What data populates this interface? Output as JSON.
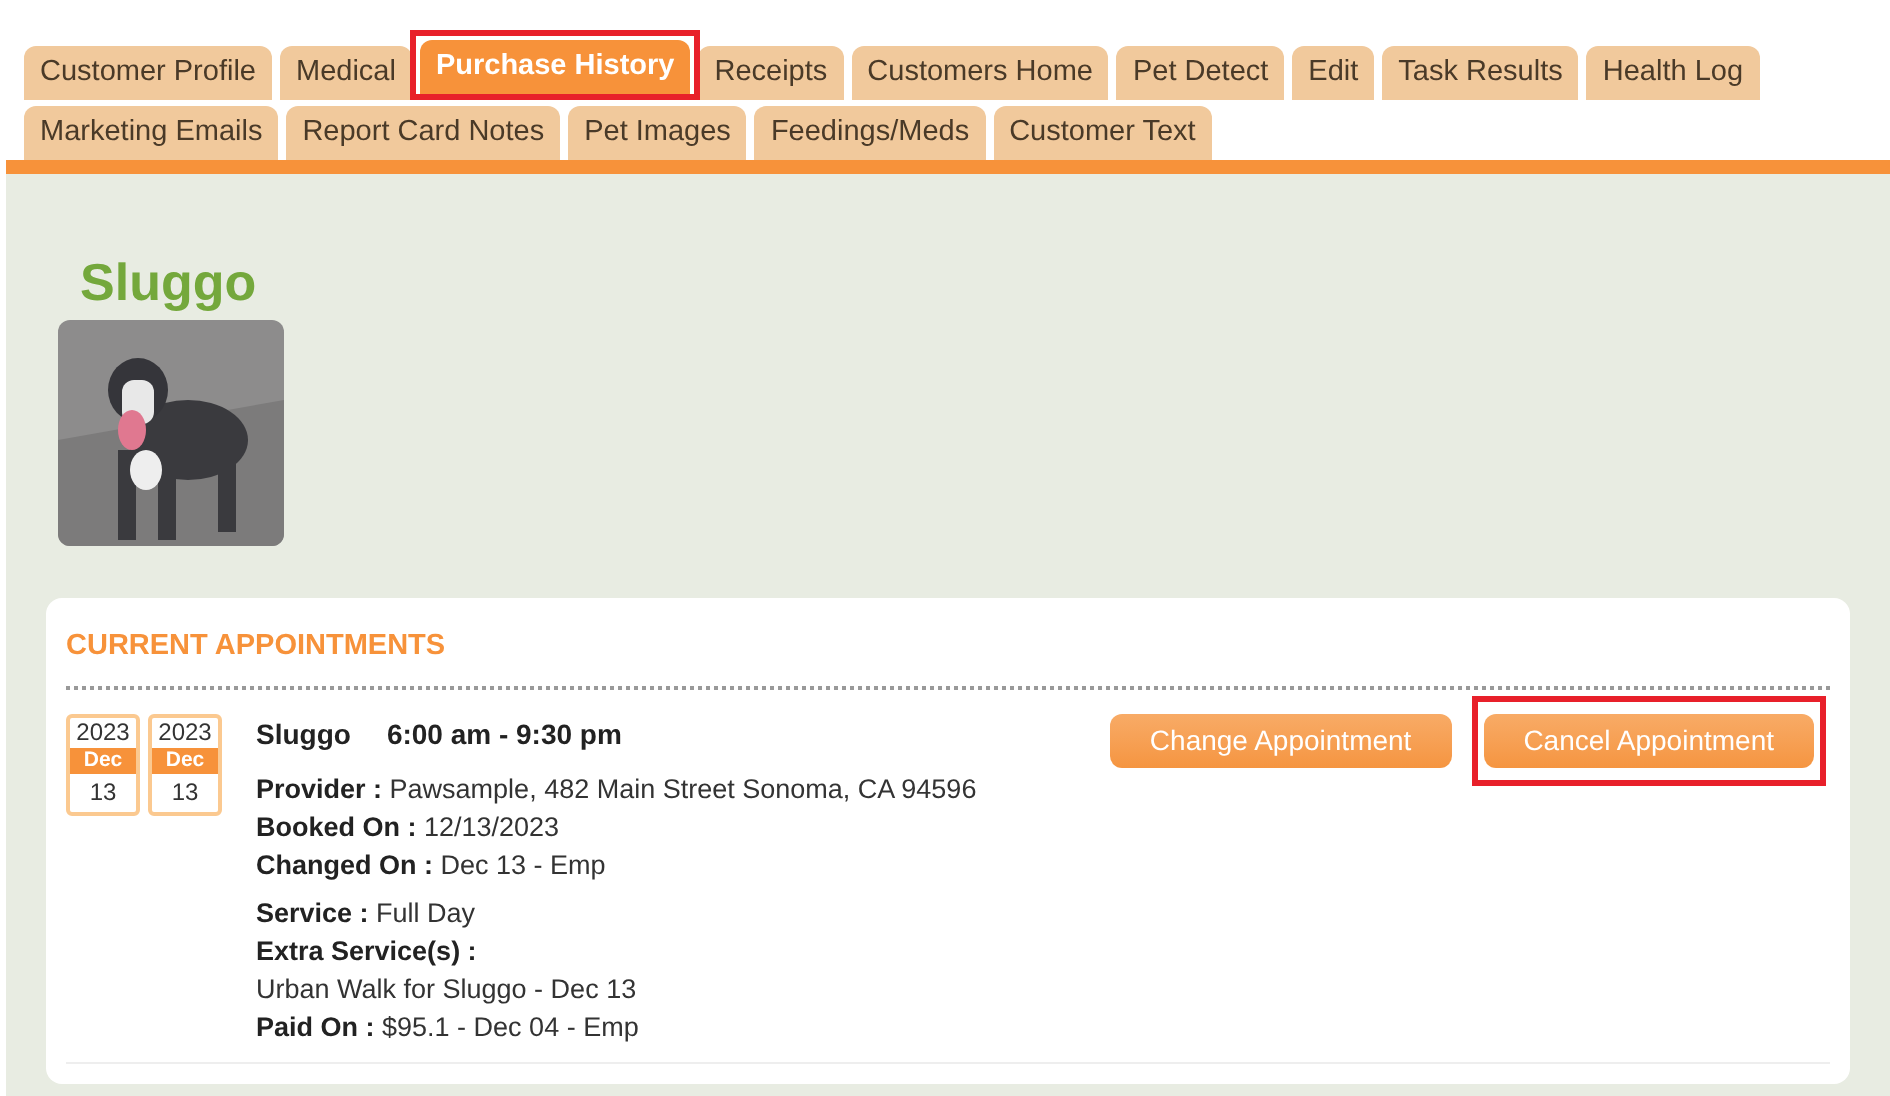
{
  "tab_rows": [
    [
      {
        "label": "Customer Profile",
        "selected": false,
        "highlighted": false
      },
      {
        "label": "Medical",
        "selected": false,
        "highlighted": false
      },
      {
        "label": "Purchase History",
        "selected": true,
        "highlighted": true
      },
      {
        "label": "Receipts",
        "selected": false,
        "highlighted": false
      },
      {
        "label": "Customers Home",
        "selected": false,
        "highlighted": false
      },
      {
        "label": "Pet Detect",
        "selected": false,
        "highlighted": false
      },
      {
        "label": "Edit",
        "selected": false,
        "highlighted": false
      },
      {
        "label": "Task Results",
        "selected": false,
        "highlighted": false
      },
      {
        "label": "Health Log",
        "selected": false,
        "highlighted": false
      }
    ],
    [
      {
        "label": "Marketing Emails",
        "selected": false,
        "highlighted": false
      },
      {
        "label": "Report Card Notes",
        "selected": false,
        "highlighted": false
      },
      {
        "label": "Pet Images",
        "selected": false,
        "highlighted": false
      },
      {
        "label": "Feedings/Meds",
        "selected": false,
        "highlighted": false
      },
      {
        "label": "Customer Text",
        "selected": false,
        "highlighted": false
      }
    ]
  ],
  "pet": {
    "name": "Sluggo"
  },
  "appointments": {
    "heading": "CURRENT APPOINTMENTS",
    "items": [
      {
        "dates": [
          {
            "year": "2023",
            "month": "Dec",
            "day": "13"
          },
          {
            "year": "2023",
            "month": "Dec",
            "day": "13"
          }
        ],
        "pet": "Sluggo",
        "time": "6:00 am - 9:30 pm",
        "details": [
          {
            "label": "Provider :",
            "value": "Pawsample, 482 Main Street Sonoma, CA 94596"
          },
          {
            "label": "Booked On :",
            "value": "12/13/2023"
          },
          {
            "label": "Changed On :",
            "value": "Dec 13 - Emp"
          }
        ],
        "service_details": [
          {
            "label": "Service :",
            "value": "Full Day"
          },
          {
            "label": "Extra Service(s) :"
          }
        ],
        "extra_service": "Urban Walk for Sluggo - Dec 13",
        "paid": {
          "label": "Paid On :",
          "value": "$95.1 - Dec 04 - Emp"
        },
        "buttons": [
          {
            "label": "Change Appointment",
            "highlighted": false
          },
          {
            "label": "Cancel Appointment",
            "highlighted": true
          }
        ]
      }
    ]
  }
}
